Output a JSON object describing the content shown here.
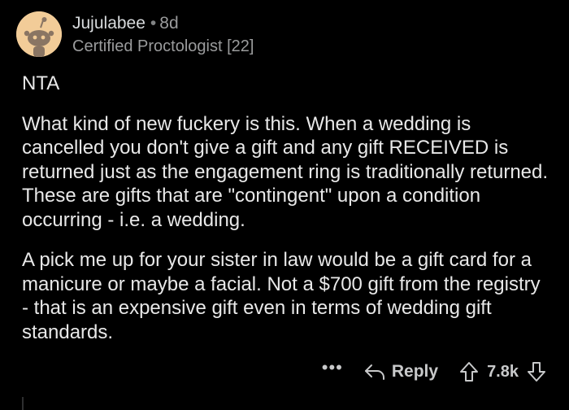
{
  "comment": {
    "username": "Jujulabee",
    "separator": "•",
    "age": "8d",
    "flair": "Certified Proctologist [22]",
    "verdict": "NTA",
    "paragraphs": [
      "What kind of new fuckery is this. When a wedding is cancelled you don't give a gift and any gift RECEIVED is returned just as the engagement ring is traditionally returned. These are gifts that are \"contingent\" upon a condition occurring - i.e. a wedding.",
      "A pick me up for your sister in law would be a gift card for a manicure or maybe a facial. Not a $700 gift from the registry - that is an expensive gift even in terms of wedding gift standards."
    ],
    "avatar_icon": "snoo-avatar-icon"
  },
  "actions": {
    "more_label": "•••",
    "reply_label": "Reply",
    "reply_icon": "reply-arrow-icon",
    "upvote_icon": "upvote-arrow-icon",
    "score": "7.8k",
    "downvote_icon": "downvote-arrow-icon"
  },
  "colors": {
    "background": "#000000",
    "text": "#e8e8e8",
    "muted": "#9a9b9c",
    "avatar_bg": "#f2cc98"
  }
}
